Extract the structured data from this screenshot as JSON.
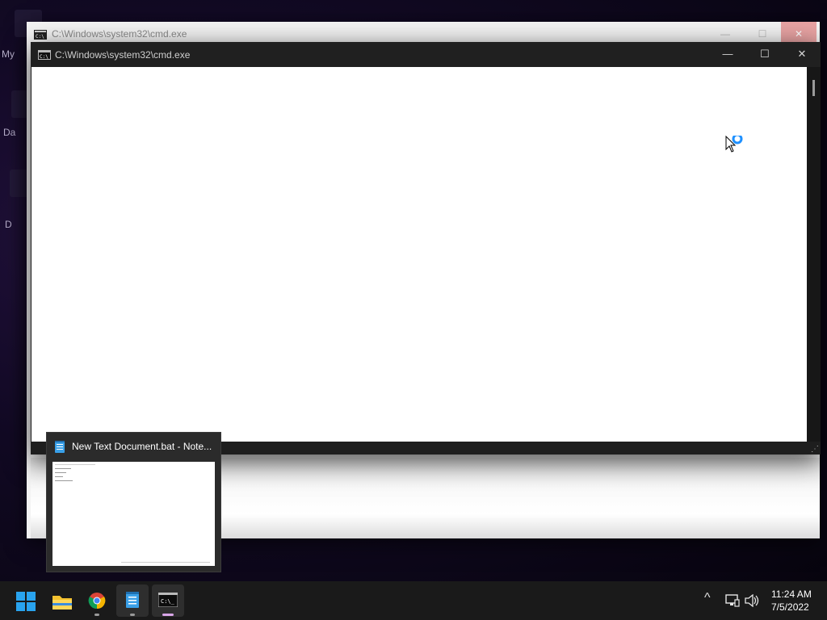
{
  "desktop": {
    "icon_labels": [
      "My",
      "Da",
      "D"
    ]
  },
  "back_window": {
    "title": "C:\\Windows\\system32\\cmd.exe",
    "icon": "cmd-icon",
    "controls": {
      "minimize": "—",
      "maximize": "☐",
      "close": "✕"
    }
  },
  "front_window": {
    "title": "C:\\Windows\\system32\\cmd.exe",
    "icon": "cmd-icon",
    "controls": {
      "minimize": "—",
      "maximize": "☐",
      "close": "✕"
    },
    "console_background": "#ffffff",
    "resize_grip": "⋰"
  },
  "preview": {
    "title": "New Text Document.bat - Note...",
    "icon": "notepad-icon"
  },
  "taskbar": {
    "apps": [
      {
        "name": "start-button",
        "icon": "windows-logo-icon"
      },
      {
        "name": "file-explorer",
        "icon": "folder-icon"
      },
      {
        "name": "chrome",
        "icon": "chrome-icon"
      },
      {
        "name": "notepad",
        "icon": "notepad-icon"
      },
      {
        "name": "command-prompt",
        "icon": "cmd-icon"
      }
    ],
    "tray": {
      "overflow_icon": "^",
      "time": "11:24 AM",
      "date": "7/5/2022"
    }
  },
  "colors": {
    "accent": "#0078d4",
    "taskbar": "#1a1a1a",
    "titlebar_dark": "#202020"
  }
}
